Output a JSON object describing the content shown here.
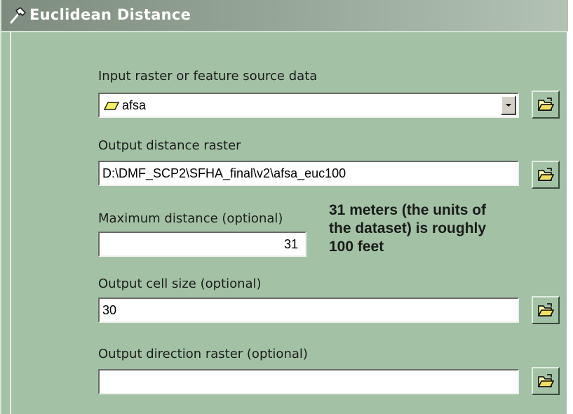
{
  "window": {
    "title": "Euclidean Distance",
    "title_icon": "hammer-icon"
  },
  "fields": {
    "input_source": {
      "label": "Input raster or feature source data",
      "value": "afsa",
      "value_icon": "polygon-layer-icon",
      "dropdown_icon": "chevron-down-icon",
      "browse_icon": "open-folder-icon"
    },
    "output_distance": {
      "label": "Output distance raster",
      "value": "D:\\DMF_SCP2\\SFHA_final\\v2\\afsa_euc100",
      "browse_icon": "open-folder-icon"
    },
    "max_distance": {
      "label": "Maximum distance (optional)",
      "value": "31"
    },
    "cell_size": {
      "label": "Output cell size (optional)",
      "value": "30",
      "browse_icon": "open-folder-icon"
    },
    "direction_raster": {
      "label": "Output direction raster (optional)",
      "value": "",
      "browse_icon": "open-folder-icon"
    }
  },
  "annotation": {
    "lines": [
      "31 meters (the units of",
      "the dataset)  is roughly",
      "100 feet"
    ]
  }
}
